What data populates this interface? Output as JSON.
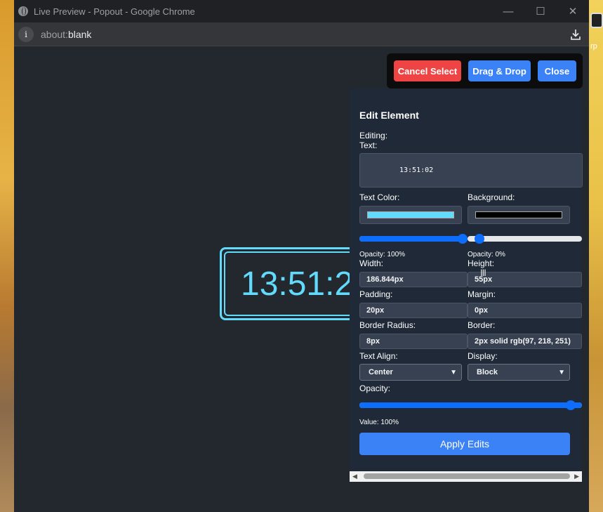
{
  "window": {
    "title": "Live Preview - Popout - Google Chrome",
    "url_host": "about:",
    "url_path": "blank"
  },
  "desktop": {
    "right_tag": "rp"
  },
  "clock": {
    "time": "13:51:2"
  },
  "toolbar": {
    "cancel_label": "Cancel Select",
    "drag_label": "Drag & Drop",
    "close_label": "Close"
  },
  "editor": {
    "heading": "Edit Element",
    "editing_label": "Editing:",
    "text_label": "Text:",
    "text_value": "13:51:02",
    "text_color_label": "Text Color:",
    "background_label": "Background:",
    "text_color": "#61dafb",
    "background_color": "#000000",
    "text_opacity_label": "Opacity: 100%",
    "text_opacity": 1.0,
    "bg_opacity_label": "Opacity: 0%",
    "bg_opacity": 0.0,
    "width_label": "Width:",
    "width_value": "186.844px",
    "height_label": "Height:",
    "height_value": "55px",
    "padding_label": "Padding:",
    "padding_value": "20px",
    "margin_label": "Margin:",
    "margin_value": "0px",
    "radius_label": "Border Radius:",
    "radius_value": "8px",
    "border_label": "Border:",
    "border_value": "2px solid rgb(97, 218, 251)",
    "align_label": "Text Align:",
    "align_value": "Center",
    "display_label": "Display:",
    "display_value": "Block",
    "opacity_label": "Opacity:",
    "opacity_value_label": "Value: 100%",
    "opacity": 1.0,
    "apply_label": "Apply Edits"
  },
  "colors": {
    "accent": "#3b82f6",
    "danger": "#ef4444",
    "clock": "#61dafb"
  }
}
